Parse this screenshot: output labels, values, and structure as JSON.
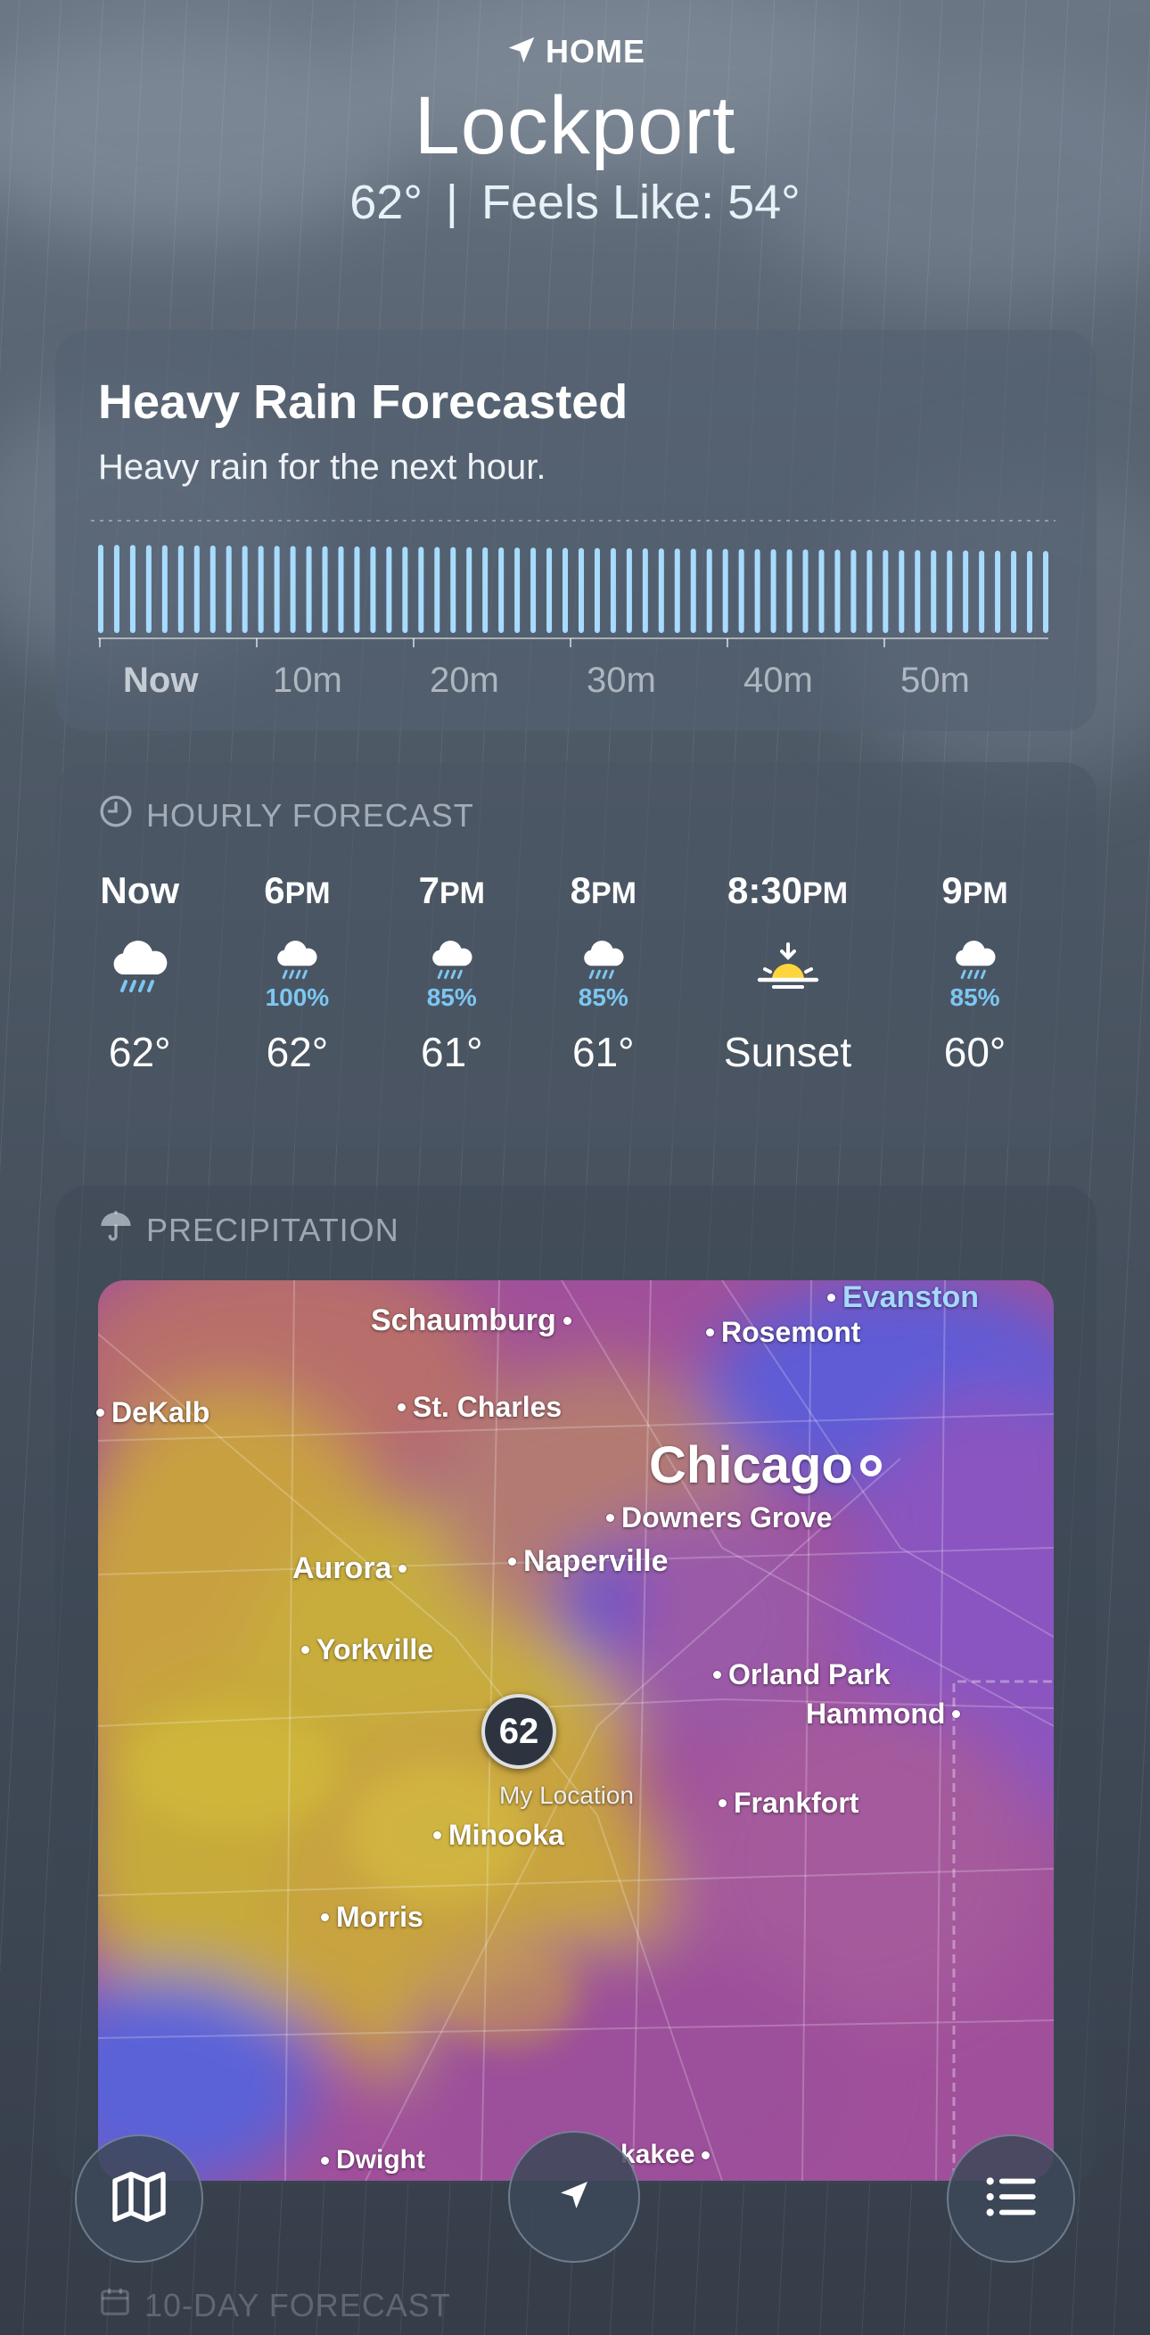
{
  "header": {
    "home_label": "HOME",
    "city": "Lockport",
    "temperature": "62°",
    "feels_like": "Feels Like: 54°"
  },
  "rain_card": {
    "title": "Heavy Rain Forecasted",
    "subtitle": "Heavy rain for the next hour.",
    "time_labels": [
      "Now",
      "10m",
      "20m",
      "30m",
      "40m",
      "50m"
    ],
    "intensity_level": 0.9
  },
  "hourly": {
    "title": "HOURLY FORECAST",
    "items": [
      {
        "time": "Now",
        "ampm": "",
        "icon": "rain-cloud-icon",
        "pct": "",
        "temp": "62°"
      },
      {
        "time": "6",
        "ampm": "PM",
        "icon": "rain-cloud-icon",
        "pct": "100%",
        "temp": "62°"
      },
      {
        "time": "7",
        "ampm": "PM",
        "icon": "rain-cloud-icon",
        "pct": "85%",
        "temp": "61°"
      },
      {
        "time": "8",
        "ampm": "PM",
        "icon": "rain-cloud-icon",
        "pct": "85%",
        "temp": "61°"
      },
      {
        "time": "8:30",
        "ampm": "PM",
        "icon": "sunset-icon",
        "pct": "",
        "temp": "Sunset"
      },
      {
        "time": "9",
        "ampm": "PM",
        "icon": "rain-cloud-icon",
        "pct": "85%",
        "temp": "60°"
      }
    ]
  },
  "precipitation": {
    "title": "PRECIPITATION",
    "cities": {
      "schaumburg": "Schaumburg",
      "rosemont": "Rosemont",
      "evanston": "Evanston",
      "dekalb": "DeKalb",
      "st_charles": "St. Charles",
      "chicago": "Chicago",
      "downers_grove": "Downers Grove",
      "aurora": "Aurora",
      "naperville": "Naperville",
      "yorkville": "Yorkville",
      "orland_park": "Orland Park",
      "hammond": "Hammond",
      "frankfort": "Frankfort",
      "minooka": "Minooka",
      "morris": "Morris",
      "dwight": "Dwight",
      "kankakee": "kakee"
    },
    "my_location_temp": "62",
    "my_location_label": "My Location"
  },
  "footer": {
    "ten_day_title": "10-DAY FORECAST"
  },
  "colors": {
    "rain_bar": "#a8dcff",
    "precip_pct": "#7cc7f2",
    "sun": "#ffd53d"
  }
}
